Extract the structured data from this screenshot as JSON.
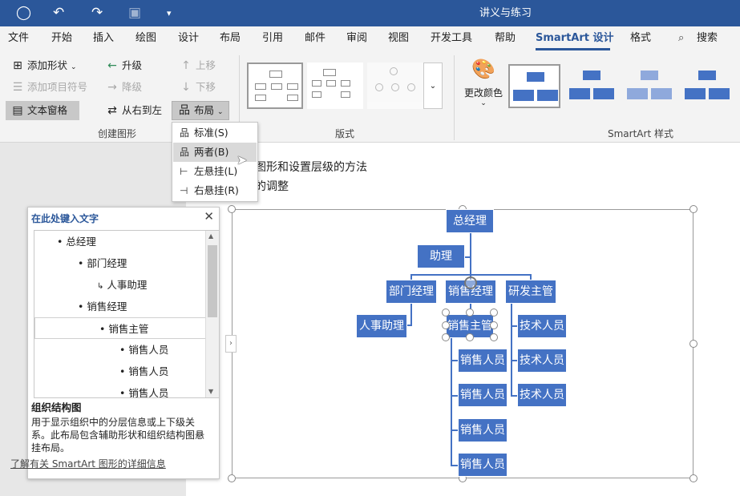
{
  "title_bar": {
    "title": "讲义与练习"
  },
  "tabs": [
    "文件",
    "开始",
    "插入",
    "绘图",
    "设计",
    "布局",
    "引用",
    "邮件",
    "审阅",
    "视图",
    "开发工具",
    "帮助",
    "SmartArt 设计",
    "格式",
    "搜索"
  ],
  "ribbon": {
    "create_graphic": {
      "add_shape": "添加形状",
      "add_bullet": "添加项目符号",
      "text_pane": "文本窗格",
      "promote": "升级",
      "demote": "降级",
      "right_to_left": "从右到左",
      "move_up": "上移",
      "move_down": "下移",
      "layout": "布局",
      "label": "创建图形"
    },
    "layouts": {
      "label": "版式"
    },
    "styles": {
      "change_colors": "更改颜色",
      "label": "SmartArt 样式"
    }
  },
  "layout_menu": {
    "items": [
      {
        "label": "标准(S)",
        "icon": "org-standard-icon"
      },
      {
        "label": "两者(B)",
        "icon": "org-both-icon"
      },
      {
        "label": "左悬挂(L)",
        "icon": "org-left-hanging-icon"
      },
      {
        "label": "右悬挂(R)",
        "icon": "org-right-hanging-icon"
      }
    ],
    "highlighted": 1
  },
  "document": {
    "line1": "图形和设置层级的方法",
    "line2": "的调整"
  },
  "text_pane": {
    "title": "在此处键入文字",
    "items": [
      "总经理",
      "部门经理",
      "人事助理",
      "销售经理",
      "销售主管",
      "销售人员",
      "销售人员",
      "销售人员"
    ],
    "desc_title": "组织结构图",
    "desc": "用于显示组织中的分层信息或上下级关系。此布局包含辅助形状和组织结构图悬挂布局。",
    "link": "了解有关 SmartArt 图形的详细信息"
  },
  "org_chart": {
    "top": "总经理",
    "assistant": "助理",
    "managers": [
      "部门经理",
      "销售经理",
      "研发主管"
    ],
    "hr": "人事助理",
    "sales_lead": "销售主管",
    "sales": [
      "销售人员",
      "销售人员",
      "销售人员",
      "销售人员"
    ],
    "tech": [
      "技术人员",
      "技术人员",
      "技术人员"
    ]
  },
  "colors": {
    "accent": "#2b579a",
    "shape": "#4472c4"
  }
}
